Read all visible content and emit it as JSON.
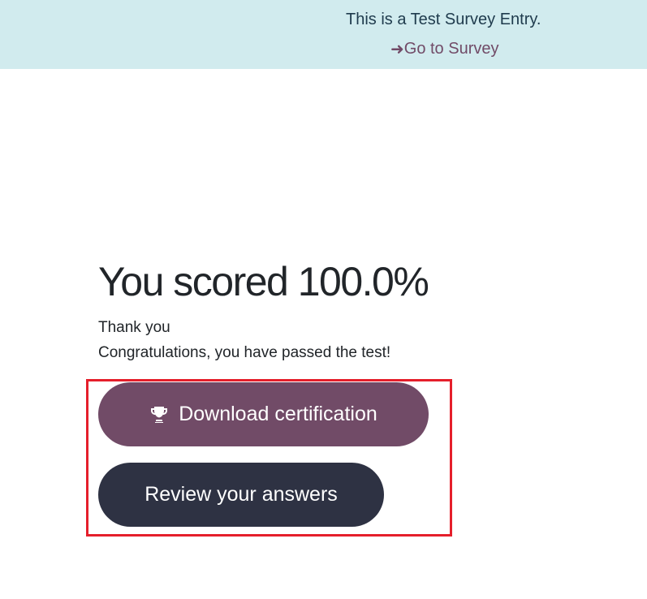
{
  "banner": {
    "message": "This is a Test Survey Entry.",
    "link_label": "Go to Survey",
    "link_icon": "arrow-right-icon"
  },
  "result": {
    "score_text": "You scored 100.0%",
    "thanks_text": "Thank you",
    "congrats_text": "Congratulations, you have passed the test!"
  },
  "actions": {
    "download_label": "Download certification",
    "download_icon": "trophy-icon",
    "review_label": "Review your answers"
  },
  "colors": {
    "banner_bg": "#d1ebee",
    "primary": "#714b67",
    "secondary": "#2e3243",
    "highlight": "#e51f2b"
  }
}
